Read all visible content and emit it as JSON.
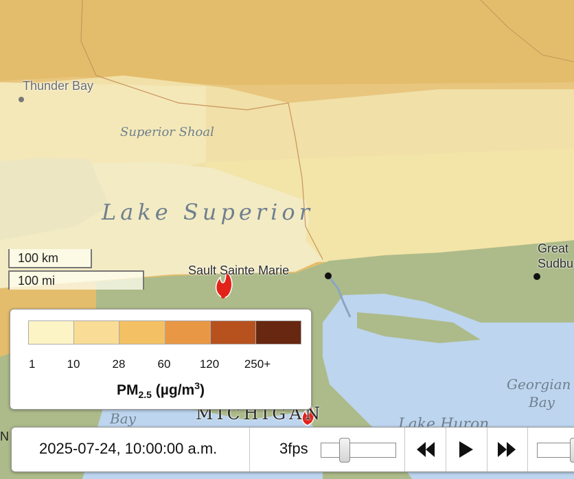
{
  "map": {
    "places": {
      "thunder_bay": "Thunder Bay",
      "sault": "Sault Sainte Marie",
      "sudbury_line1": "Great",
      "sudbury_line2": "Sudbu",
      "michigan": "MICHIGAN",
      "edge_n": "N"
    },
    "water": {
      "superior_shoal": "Superior Shoal",
      "lake_superior": "Lake Superior",
      "georgian_line1": "Georgian",
      "georgian_line2": "Bay",
      "bay": "Bay",
      "lake_huron": "Lake Huron"
    },
    "fire_icons": [
      "wildfire-icon",
      "wildfire-icon"
    ]
  },
  "scale": {
    "km": "100 km",
    "mi": "100 mi"
  },
  "legend": {
    "title_main": "PM",
    "title_sub": "2.5",
    "title_units": "(µg/m",
    "title_sup": "3",
    "title_end": ")",
    "ticks": [
      "1",
      "10",
      "28",
      "60",
      "120",
      "250+"
    ],
    "colors": [
      "#fdf4c6",
      "#f9dd96",
      "#f3c063",
      "#e89745",
      "#b7521f",
      "#682710"
    ]
  },
  "controls": {
    "timestamp": "2025-07-24, 10:00:00 a.m.",
    "fps": "3fps",
    "fps_slider_value": 0.14,
    "opacity_slider_value": 0.8
  }
}
